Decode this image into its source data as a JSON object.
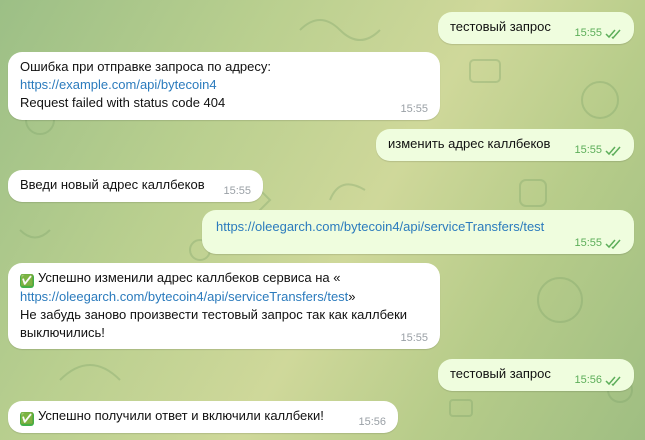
{
  "messages": [
    {
      "dir": "out",
      "text": "тестовый запрос",
      "time": "15:55"
    },
    {
      "dir": "in",
      "line1": "Ошибка при отправке запроса по адресу:",
      "link": "https://example.com/api/bytecoin4",
      "line3": "Request failed with status code 404",
      "time": "15:55"
    },
    {
      "dir": "out",
      "text": "изменить адрес каллбеков",
      "time": "15:55"
    },
    {
      "dir": "in",
      "text": "Введи новый адрес каллбеков",
      "time": "15:55"
    },
    {
      "dir": "out",
      "link": "https://oleegarch.com/bytecoin4/api/serviceTransfers/test",
      "time": "15:55"
    },
    {
      "dir": "in",
      "emoji": "✅",
      "line1": "Успешно изменили адрес каллбеков сервиса на «",
      "link": "https://oleegarch.com/bytecoin4/api/serviceTransfers/test",
      "link_suffix": "»",
      "line3": "Не забудь заново произвести тестовый запрос так как каллбеки",
      "line4": "выключились!",
      "time": "15:55"
    },
    {
      "dir": "out",
      "text": "тестовый запрос",
      "time": "15:56"
    },
    {
      "dir": "in",
      "emoji": "✅",
      "text": "Успешно получили ответ и включили каллбеки!",
      "time": "15:56"
    }
  ],
  "icons": {
    "read_receipt": "double-check-icon",
    "success": "check-mark-emoji"
  },
  "colors": {
    "incoming": "#ffffff",
    "outgoing": "#effdde",
    "link": "#2b7bbd",
    "outgoing_time": "#5dae5a"
  }
}
